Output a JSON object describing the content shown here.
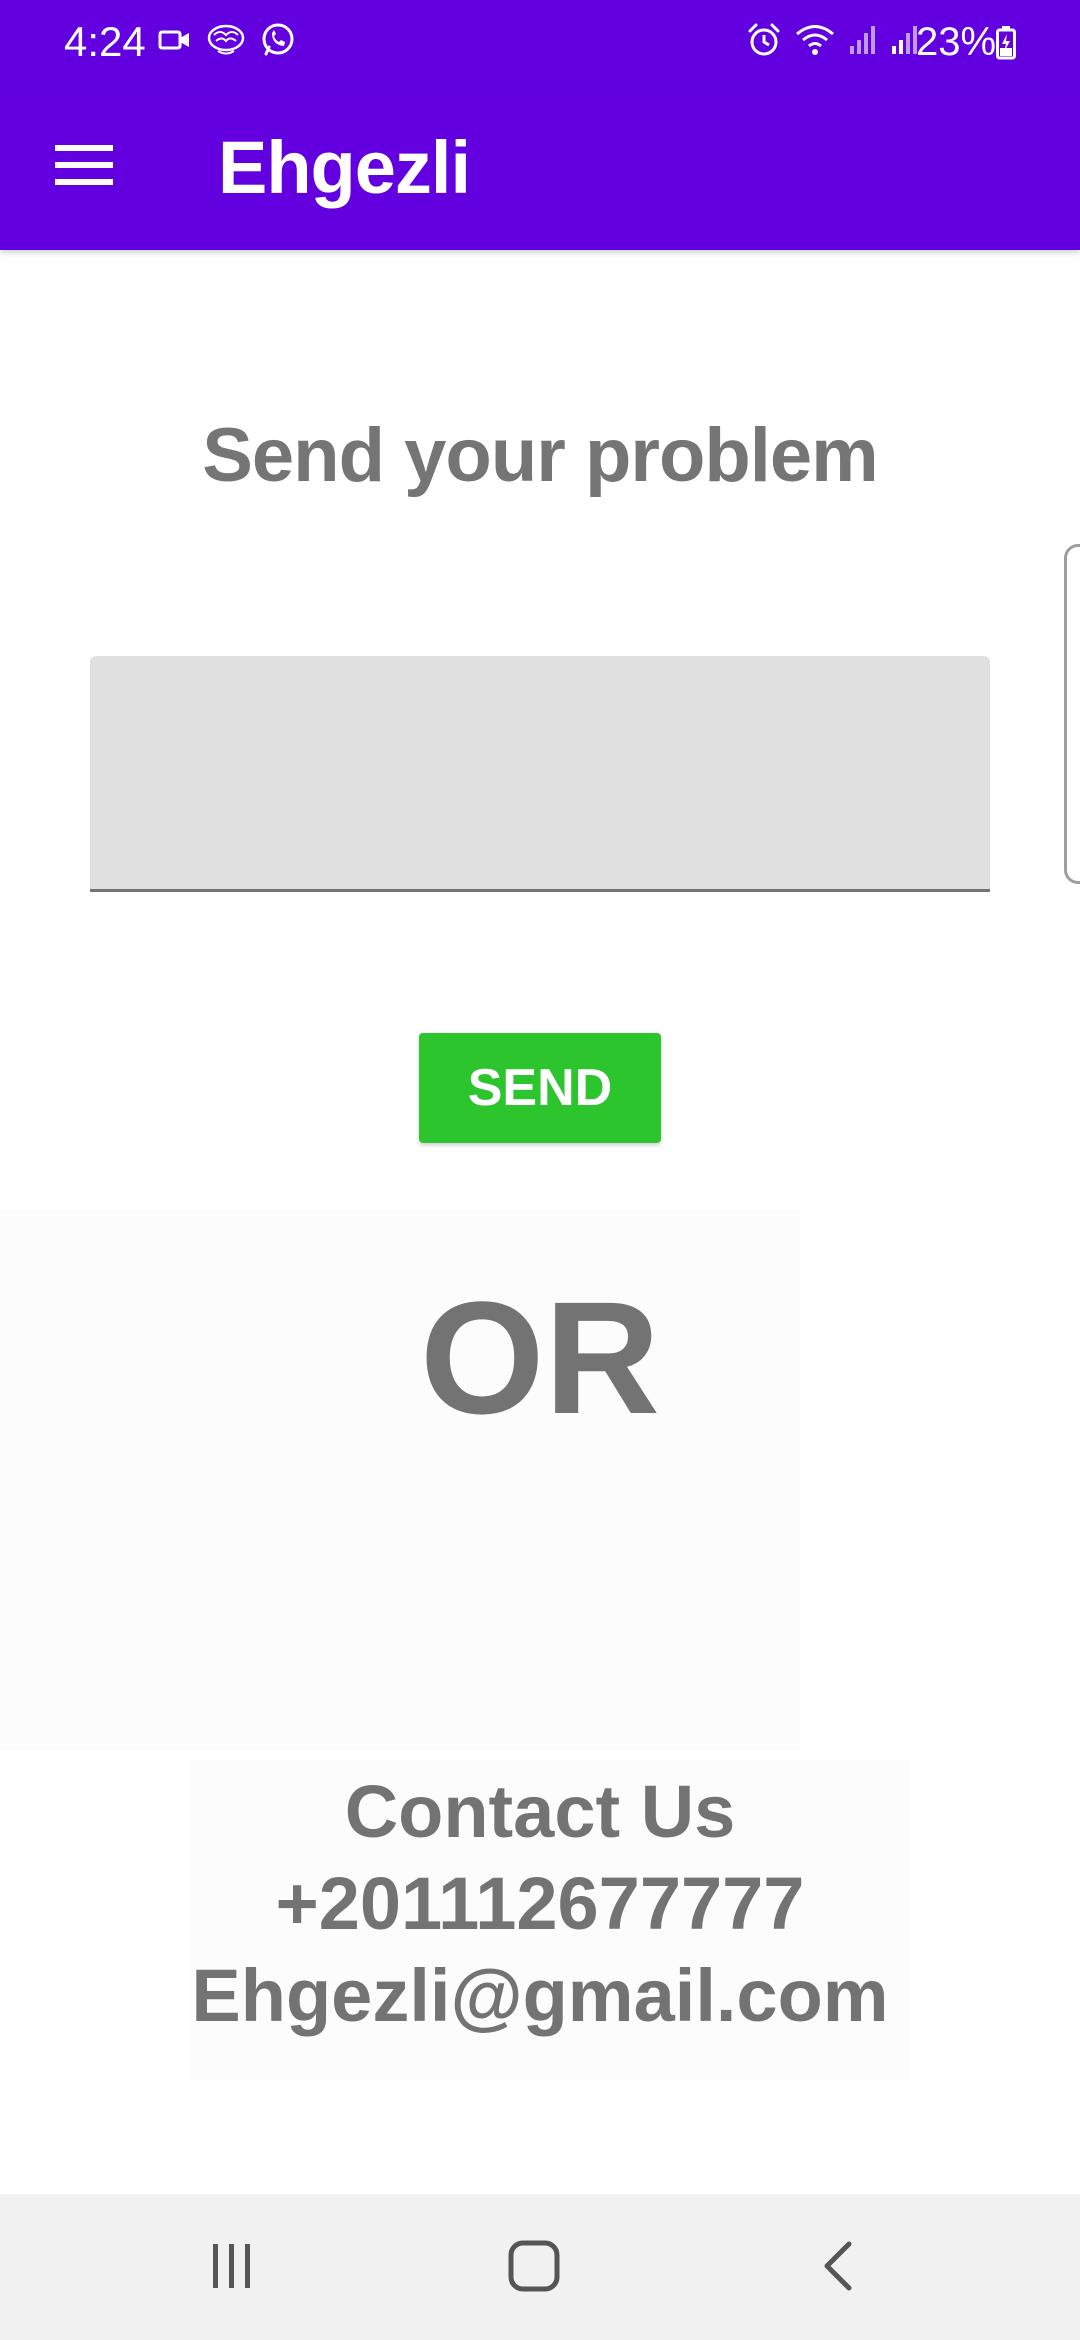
{
  "status_bar": {
    "time": "4:24",
    "battery_percent": "23%",
    "left_icons": [
      "video-camera-icon",
      "brain-icon",
      "whatsapp-icon"
    ],
    "right_icons": [
      "alarm-icon",
      "wifi-icon",
      "signal-icon",
      "signal-icon"
    ],
    "color": "#6200e0"
  },
  "app_bar": {
    "menu_icon": "hamburger-menu-icon",
    "title": "Ehgezli",
    "color": "#6200e0"
  },
  "main": {
    "heading": "Send your problem",
    "problem_input": {
      "value": "",
      "placeholder": ""
    },
    "send_button_label": "SEND",
    "send_button_color": "#2cc52e",
    "or_label": "OR",
    "contact": {
      "title": "Contact Us",
      "phone": "+201112677777",
      "email": "Ehgezli@gmail.com"
    }
  },
  "nav_bar": {
    "buttons": [
      "recent-apps-icon",
      "home-icon",
      "back-icon"
    ]
  }
}
